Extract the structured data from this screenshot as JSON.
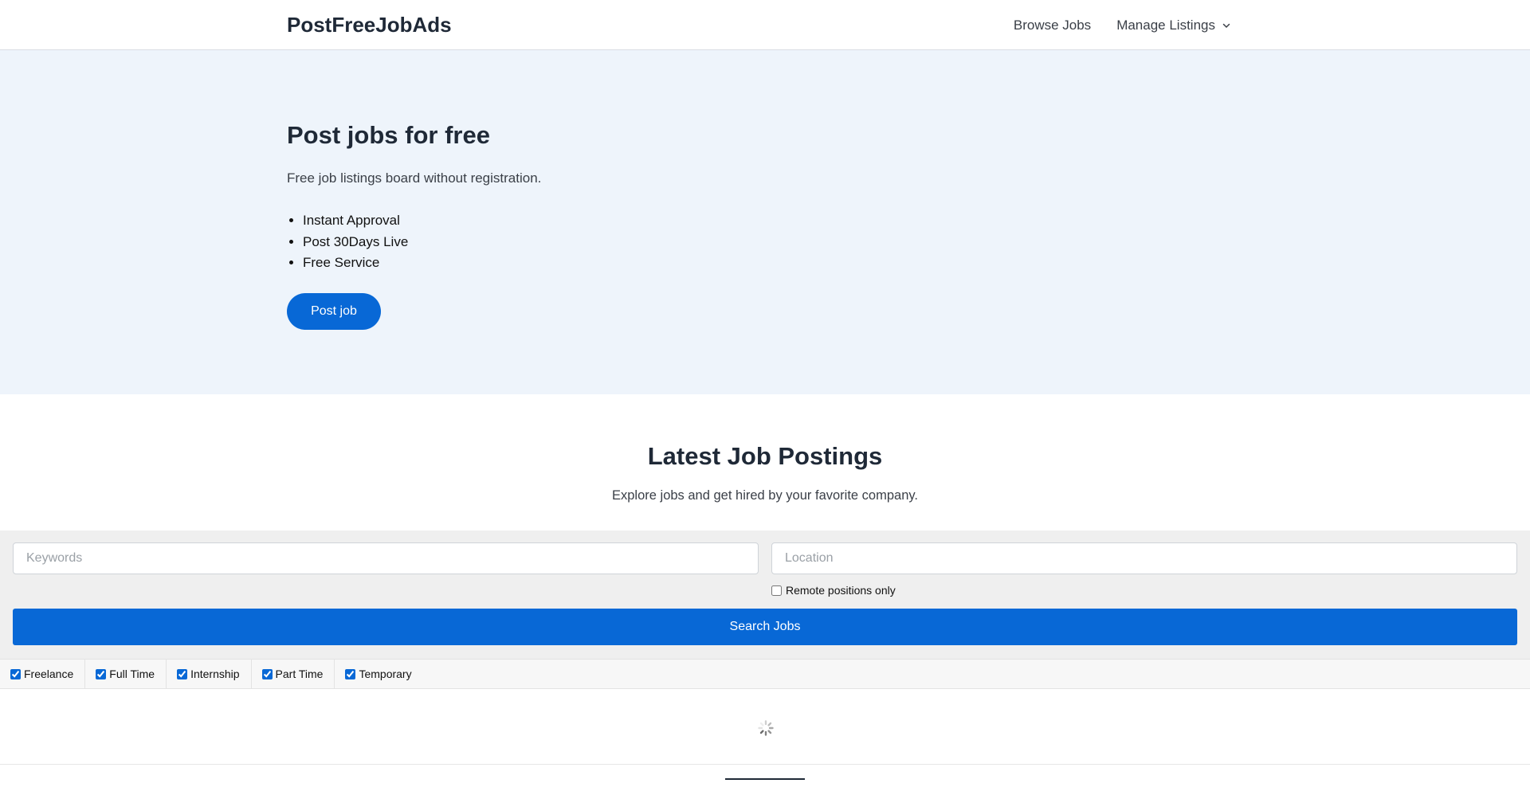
{
  "header": {
    "brand": "PostFreeJobAds",
    "nav": {
      "browse": "Browse Jobs",
      "manage": "Manage Listings"
    }
  },
  "hero": {
    "title": "Post jobs for free",
    "subtitle": "Free job listings board without registration.",
    "features": [
      "Instant Approval",
      "Post 30Days Live",
      "Free Service"
    ],
    "button": "Post job"
  },
  "latest": {
    "title": "Latest Job Postings",
    "subtitle": "Explore jobs and get hired by your favorite company."
  },
  "search": {
    "keywords_placeholder": "Keywords",
    "location_placeholder": "Location",
    "remote_label": "Remote positions only",
    "remote_checked": false,
    "button": "Search Jobs"
  },
  "filters": [
    {
      "label": "Freelance",
      "checked": true
    },
    {
      "label": "Full Time",
      "checked": true
    },
    {
      "label": "Internship",
      "checked": true
    },
    {
      "label": "Part Time",
      "checked": true
    },
    {
      "label": "Temporary",
      "checked": true
    }
  ],
  "colors": {
    "accent": "#0868d6",
    "hero_bg": "#eef4fb",
    "search_bg": "#efefef"
  }
}
